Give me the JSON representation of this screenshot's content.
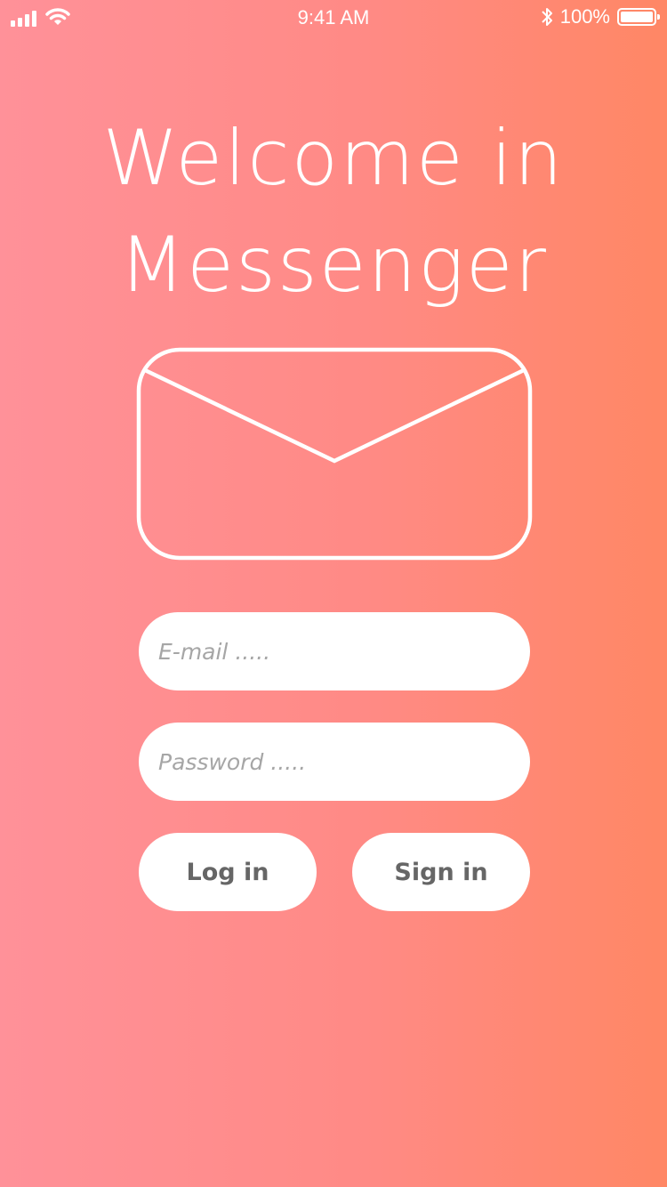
{
  "status_bar": {
    "time": "9:41 AM",
    "battery_percent": "100%",
    "signal_icon": "signal-bars-icon",
    "wifi_icon": "wifi-icon",
    "bluetooth_icon": "bluetooth-icon",
    "battery_icon": "battery-icon",
    "battery_level": 1.0
  },
  "title": {
    "line1": "Welcome in",
    "line2": "Messenger"
  },
  "logo": {
    "icon": "envelope-icon"
  },
  "form": {
    "email_placeholder": "E-mail .....",
    "email_value": "",
    "password_placeholder": "Password .....",
    "password_value": ""
  },
  "buttons": {
    "login_label": "Log in",
    "signin_label": "Sign in"
  },
  "colors": {
    "gradient_start": "#ff9199",
    "gradient_end": "#ff8765",
    "button_text": "#666666",
    "placeholder_text": "#a6a6a6"
  }
}
